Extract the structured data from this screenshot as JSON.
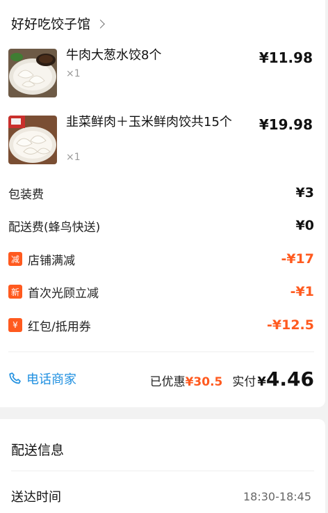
{
  "shop": {
    "name": "好好吃饺子馆"
  },
  "items": [
    {
      "name": "牛肉大葱水饺8个",
      "qty": "×1",
      "price": "¥11.98"
    },
    {
      "name": "韭菜鲜肉＋玉米鲜肉饺共15个",
      "qty": "×1",
      "price": "¥19.98"
    }
  ],
  "fees": [
    {
      "label": "包装费",
      "value": "¥3"
    },
    {
      "label": "配送费(蜂鸟快送)",
      "value": "¥0"
    }
  ],
  "discounts": [
    {
      "badge": "减",
      "label": "店铺满减",
      "value": "-¥17"
    },
    {
      "badge": "新",
      "label": "首次光顾立减",
      "value": "-¥1"
    },
    {
      "badge": "¥",
      "label": "红包/抵用券",
      "value": "-¥12.5"
    }
  ],
  "footer": {
    "call_label": "电话商家",
    "saved_label": "已优惠",
    "saved_value": "¥30.5",
    "paid_label": "实付",
    "paid_currency": "¥",
    "paid_value": "4.46"
  },
  "delivery": {
    "title": "配送信息",
    "time_label": "送达时间",
    "time_value": "18:30-18:45"
  },
  "colors": {
    "accent_red": "#ff5a1f",
    "link_blue": "#1e8fe0"
  },
  "icons": {
    "shop_chevron": "chevron-right-icon",
    "call": "phone-icon"
  }
}
